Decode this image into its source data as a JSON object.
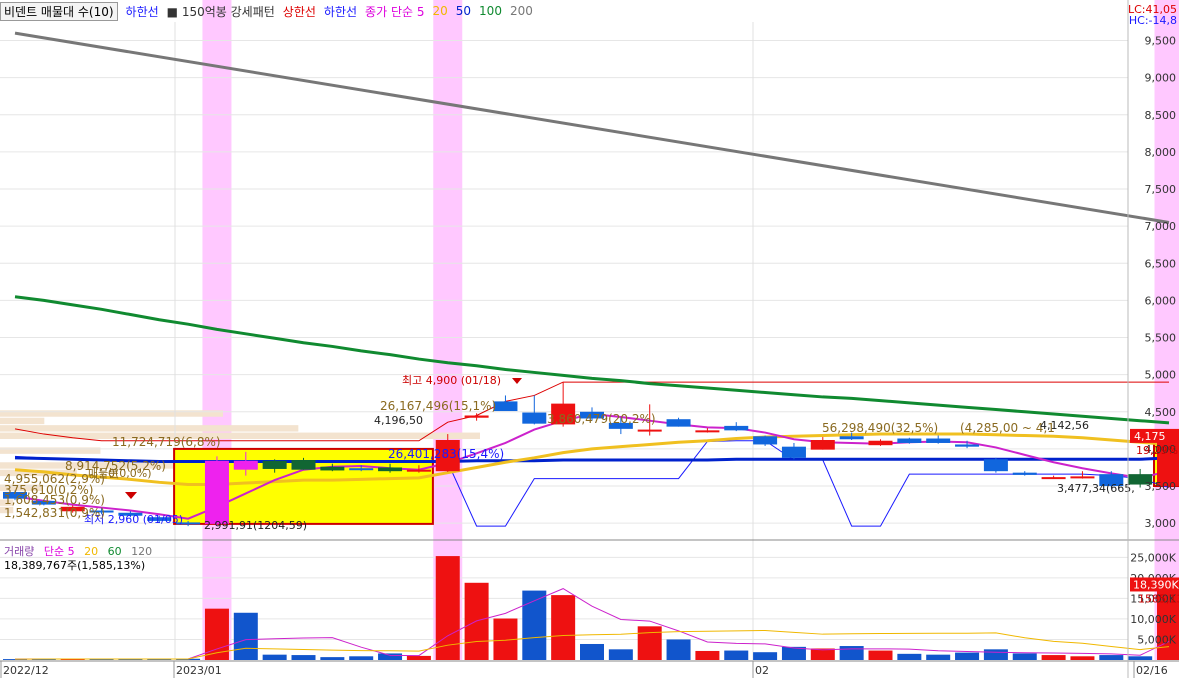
{
  "legend": {
    "title": "비덴트 매물대 수(10)",
    "items": [
      {
        "text": "하한선",
        "color": "#1a1aff"
      },
      {
        "text": "■ 150억봉 강세패턴",
        "color": "#333333"
      },
      {
        "text": "상한선",
        "color": "#dd0000"
      },
      {
        "text": "하한선",
        "color": "#1a1aff"
      },
      {
        "text": "종가 단순 5",
        "color": "#dd00dd"
      },
      {
        "text": "20",
        "color": "#f0b800"
      },
      {
        "text": "50",
        "color": "#0022cc"
      },
      {
        "text": "100",
        "color": "#108a30"
      },
      {
        "text": "200",
        "color": "#777777"
      }
    ]
  },
  "corner": {
    "lc": "LC:41,05",
    "hc": "HC:-14,8"
  },
  "price_axis_labels": {
    "last_price": "4,175",
    "last_pct": "19,29%"
  },
  "annotations": {
    "high": "최고 4,900 (01/18)",
    "low": "최저 2,960 (01/05)",
    "vp1": "26,167,496(15,1%)",
    "vp2": "26,401,283(15,4%)",
    "vp3": "11,724,719(6,8%)",
    "vp4": "8,914,752(5,2%)",
    "vp5": "4,955,062(2,9%)",
    "vp6": "1,608,453(0,9%)",
    "vp7": "1,542,831(0,9%)",
    "vp8": "375,610(0,2%)",
    "vp9": "3,860,479(20,2%)",
    "vp10": "56,298,490(32,5%)",
    "vp11": "0(0,0%)",
    "lbl_a": "4,196,50",
    "lbl_b": "2,991,91(1204,59)",
    "lbl_c": "4,142,56",
    "lbl_d": "3,477,34(665,",
    "lbl_e": "(4,285,00 ~ 4,1",
    "lbl_f": "매물분"
  },
  "volume": {
    "legend": [
      {
        "text": "거래량",
        "color": "#8844aa"
      },
      {
        "text": "단순 5",
        "color": "#dd00dd"
      },
      {
        "text": "20",
        "color": "#f0b800"
      },
      {
        "text": "60",
        "color": "#108a30"
      },
      {
        "text": "120",
        "color": "#777777"
      }
    ],
    "value_text": "18,389,767주(1,585,13%)",
    "last_label": "18,390K",
    "last_pct": "1585,13"
  },
  "x_axis_labels": [
    "2022/12",
    "2023/01",
    "02",
    "02/16"
  ],
  "chart_data": {
    "type": "candlestick",
    "price_axis": {
      "ticks": [
        3000,
        3500,
        4000,
        4500,
        5000,
        5500,
        6000,
        6500,
        7000,
        7500,
        8000,
        8500,
        9000,
        9500
      ],
      "range": [
        2800,
        9750
      ]
    },
    "volume_axis": {
      "ticks": [
        5000,
        10000,
        15000,
        20000,
        25000
      ],
      "unit": "K",
      "range": [
        0,
        28000
      ]
    },
    "candles": [
      {
        "o": 3420,
        "h": 3440,
        "l": 3310,
        "c": 3330
      },
      {
        "o": 3300,
        "h": 3320,
        "l": 3240,
        "c": 3250
      },
      {
        "o": 3160,
        "h": 3240,
        "l": 3140,
        "c": 3220
      },
      {
        "o": 3150,
        "h": 3200,
        "l": 3120,
        "c": 3170
      },
      {
        "o": 3140,
        "h": 3160,
        "l": 3080,
        "c": 3100
      },
      {
        "o": 3080,
        "h": 3100,
        "l": 3010,
        "c": 3030
      },
      {
        "o": 3010,
        "h": 3030,
        "l": 2960,
        "c": 2990
      },
      {
        "o": 2990,
        "h": 3900,
        "l": 2960,
        "c": 3840
      },
      {
        "o": 3840,
        "h": 3960,
        "l": 3640,
        "c": 3720
      },
      {
        "o": 3730,
        "h": 3860,
        "l": 3680,
        "c": 3840
      },
      {
        "o": 3850,
        "h": 3880,
        "l": 3720,
        "c": 3720
      },
      {
        "o": 3760,
        "h": 3800,
        "l": 3700,
        "c": 3710
      },
      {
        "o": 3720,
        "h": 3780,
        "l": 3700,
        "c": 3740
      },
      {
        "o": 3750,
        "h": 3800,
        "l": 3680,
        "c": 3700
      },
      {
        "o": 3700,
        "h": 3780,
        "l": 3680,
        "c": 3720
      },
      {
        "o": 3700,
        "h": 4200,
        "l": 3690,
        "c": 4120
      },
      {
        "o": 4420,
        "h": 4480,
        "l": 4380,
        "c": 4450
      },
      {
        "o": 4640,
        "h": 4720,
        "l": 4520,
        "c": 4510
      },
      {
        "o": 4490,
        "h": 4720,
        "l": 4330,
        "c": 4340
      },
      {
        "o": 4330,
        "h": 4900,
        "l": 4300,
        "c": 4610
      },
      {
        "o": 4500,
        "h": 4560,
        "l": 4380,
        "c": 4410
      },
      {
        "o": 4350,
        "h": 4420,
        "l": 4200,
        "c": 4270
      },
      {
        "o": 4250,
        "h": 4600,
        "l": 4180,
        "c": 4260
      },
      {
        "o": 4400,
        "h": 4420,
        "l": 4300,
        "c": 4300
      },
      {
        "o": 4240,
        "h": 4280,
        "l": 4220,
        "c": 4250
      },
      {
        "o": 4310,
        "h": 4360,
        "l": 4240,
        "c": 4250
      },
      {
        "o": 4170,
        "h": 4180,
        "l": 4040,
        "c": 4060
      },
      {
        "o": 4030,
        "h": 4080,
        "l": 3860,
        "c": 3880
      },
      {
        "o": 3990,
        "h": 4160,
        "l": 3990,
        "c": 4120
      },
      {
        "o": 4170,
        "h": 4220,
        "l": 4120,
        "c": 4130
      },
      {
        "o": 4110,
        "h": 4130,
        "l": 4040,
        "c": 4050
      },
      {
        "o": 4080,
        "h": 4150,
        "l": 4070,
        "c": 4140
      },
      {
        "o": 4140,
        "h": 4180,
        "l": 4070,
        "c": 4080
      },
      {
        "o": 4060,
        "h": 4110,
        "l": 4010,
        "c": 4030
      },
      {
        "o": 3860,
        "h": 3880,
        "l": 3680,
        "c": 3700
      },
      {
        "o": 3680,
        "h": 3700,
        "l": 3640,
        "c": 3650
      },
      {
        "o": 3620,
        "h": 3640,
        "l": 3600,
        "c": 3610
      },
      {
        "o": 3620,
        "h": 3700,
        "l": 3600,
        "c": 3630
      },
      {
        "o": 3660,
        "h": 3700,
        "l": 3480,
        "c": 3500
      },
      {
        "o": 3520,
        "h": 3730,
        "l": 3480,
        "c": 3660
      },
      {
        "o": 3500,
        "h": 4200,
        "l": 3480,
        "c": 4175
      }
    ],
    "candle_colors": [
      "blue",
      "blue",
      "red",
      "blue",
      "blue",
      "blue",
      "blue",
      "magenta",
      "magenta",
      "green",
      "green",
      "green",
      "blue",
      "green",
      "red",
      "red",
      "red",
      "blue",
      "blue",
      "red",
      "blue",
      "blue",
      "red",
      "blue",
      "red",
      "blue",
      "blue",
      "blue",
      "red",
      "blue",
      "red",
      "blue",
      "blue",
      "blue",
      "blue",
      "blue",
      "red",
      "red",
      "blue",
      "green",
      "red"
    ],
    "volume": [
      220,
      240,
      260,
      210,
      230,
      250,
      300,
      12500,
      11500,
      1300,
      1200,
      700,
      900,
      1600,
      1000,
      25300,
      18800,
      10100,
      16900,
      15800,
      3900,
      2600,
      8200,
      5000,
      2200,
      2300,
      1900,
      3200,
      2800,
      3400,
      2300,
      1500,
      1300,
      1800,
      2600,
      1600,
      1200,
      900,
      1200,
      900,
      18390
    ],
    "volume_colors": [
      "blue",
      "blue",
      "red",
      "blue",
      "blue",
      "blue",
      "blue",
      "red",
      "blue",
      "blue",
      "blue",
      "blue",
      "blue",
      "blue",
      "red",
      "red",
      "red",
      "red",
      "blue",
      "red",
      "blue",
      "blue",
      "red",
      "blue",
      "red",
      "blue",
      "blue",
      "blue",
      "red",
      "blue",
      "red",
      "blue",
      "blue",
      "blue",
      "blue",
      "blue",
      "red",
      "red",
      "blue",
      "blue",
      "red"
    ],
    "ma200": [
      9600,
      7050
    ],
    "ma100": [
      6050,
      6000,
      5940,
      5880,
      5810,
      5740,
      5680,
      5610,
      5550,
      5490,
      5430,
      5380,
      5320,
      5270,
      5210,
      5160,
      5120,
      5070,
      5030,
      4990,
      4950,
      4920,
      4880,
      4850,
      4820,
      4790,
      4760,
      4730,
      4700,
      4680,
      4650,
      4620,
      4590,
      4560,
      4530,
      4500,
      4470,
      4440,
      4410,
      4380,
      4350
    ],
    "ma50": [
      3880,
      3870,
      3860,
      3850,
      3840,
      3830,
      3830,
      3830,
      3830,
      3830,
      3830,
      3830,
      3830,
      3830,
      3830,
      3830,
      3840,
      3840,
      3840,
      3850,
      3850,
      3850,
      3850,
      3850,
      3850,
      3860,
      3860,
      3860,
      3860,
      3860,
      3860,
      3860,
      3860,
      3860,
      3860,
      3860,
      3860,
      3860,
      3860,
      3860,
      3880
    ],
    "ma20": [
      3720,
      3690,
      3650,
      3620,
      3590,
      3550,
      3520,
      3520,
      3540,
      3560,
      3580,
      3580,
      3590,
      3600,
      3610,
      3680,
      3750,
      3820,
      3880,
      3950,
      4000,
      4030,
      4060,
      4090,
      4110,
      4140,
      4160,
      4170,
      4180,
      4190,
      4200,
      4200,
      4200,
      4200,
      4190,
      4180,
      4170,
      4150,
      4120,
      4090,
      4060
    ],
    "ma5": [
      3360,
      3300,
      3250,
      3210,
      3170,
      3120,
      3060,
      3220,
      3400,
      3580,
      3720,
      3760,
      3770,
      3740,
      3720,
      3810,
      3940,
      4080,
      4260,
      4380,
      4470,
      4430,
      4380,
      4330,
      4290,
      4280,
      4220,
      4130,
      4090,
      4080,
      4070,
      4090,
      4100,
      4090,
      4020,
      3920,
      3820,
      3740,
      3670,
      3610,
      3700
    ],
    "upper_band": [
      4270,
      4200,
      4150,
      4110,
      4110,
      4110,
      4110,
      4110,
      4110,
      4110,
      4110,
      4110,
      4110,
      4110,
      4110,
      4360,
      4450,
      4640,
      4720,
      4900,
      4900,
      4900,
      4900,
      4900,
      4900,
      4900,
      4900,
      4900,
      4900,
      4900,
      4900,
      4900,
      4900,
      4900,
      4900,
      4900,
      4900,
      4900,
      4900,
      4900,
      4900
    ],
    "lower_band": [
      3900,
      3880,
      3860,
      3840,
      3830,
      3820,
      3820,
      3820,
      3820,
      3820,
      3820,
      3820,
      3820,
      3820,
      3820,
      3820,
      2960,
      2960,
      3600,
      3600,
      3600,
      3600,
      3600,
      3600,
      4100,
      4110,
      4110,
      3850,
      3850,
      2960,
      2960,
      3660,
      3660,
      3660,
      3660,
      3660,
      3660,
      3660,
      3640,
      3600,
      3480
    ],
    "volume_profile": [
      {
        "price_low": 4420,
        "price_high": 4520,
        "share": 15.1
      },
      {
        "price_low": 4320,
        "price_high": 4420,
        "share": 3.0
      },
      {
        "price_low": 4220,
        "price_high": 4320,
        "share": 20.2
      },
      {
        "price_low": 4120,
        "price_high": 4220,
        "share": 32.5
      },
      {
        "price_low": 3720,
        "price_high": 3820,
        "share": 15.4
      },
      {
        "price_low": 3920,
        "price_high": 4020,
        "share": 6.8
      },
      {
        "price_low": 3620,
        "price_high": 3720,
        "share": 5.2
      },
      {
        "price_low": 3420,
        "price_high": 3520,
        "share": 2.9
      },
      {
        "price_low": 3220,
        "price_high": 3320,
        "share": 0.9
      },
      {
        "price_low": 3120,
        "price_high": 3220,
        "share": 0.9
      }
    ]
  }
}
